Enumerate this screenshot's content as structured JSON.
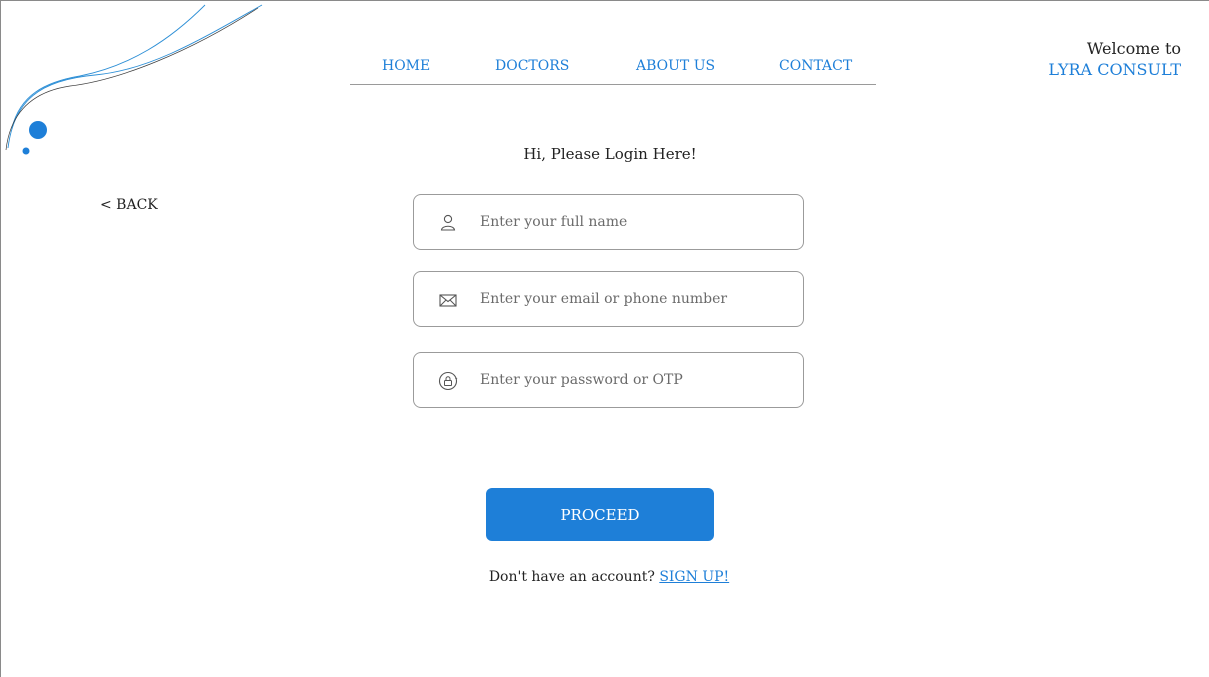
{
  "nav": {
    "items": [
      {
        "label": "HOME"
      },
      {
        "label": "DOCTORS"
      },
      {
        "label": "ABOUT US"
      },
      {
        "label": "CONTACT"
      }
    ]
  },
  "brand": {
    "welcome": "Welcome to",
    "name": "LYRA CONSULT"
  },
  "back_label": "< BACK",
  "login": {
    "heading": "Hi, Please Login Here!",
    "fields": [
      {
        "icon": "user-icon",
        "placeholder": "Enter your full name",
        "value": ""
      },
      {
        "icon": "envelope-icon",
        "placeholder": "Enter your email or phone number",
        "value": ""
      },
      {
        "icon": "lock-icon",
        "placeholder": "Enter your password or OTP",
        "value": ""
      }
    ],
    "proceed_label": "PROCEED",
    "signup_prompt": "Don't have an account?",
    "signup_link": "SIGN UP!"
  },
  "colors": {
    "accent": "#1e7fd8",
    "text": "#222222",
    "border": "#9b9b9b",
    "background": "#ffffff"
  }
}
